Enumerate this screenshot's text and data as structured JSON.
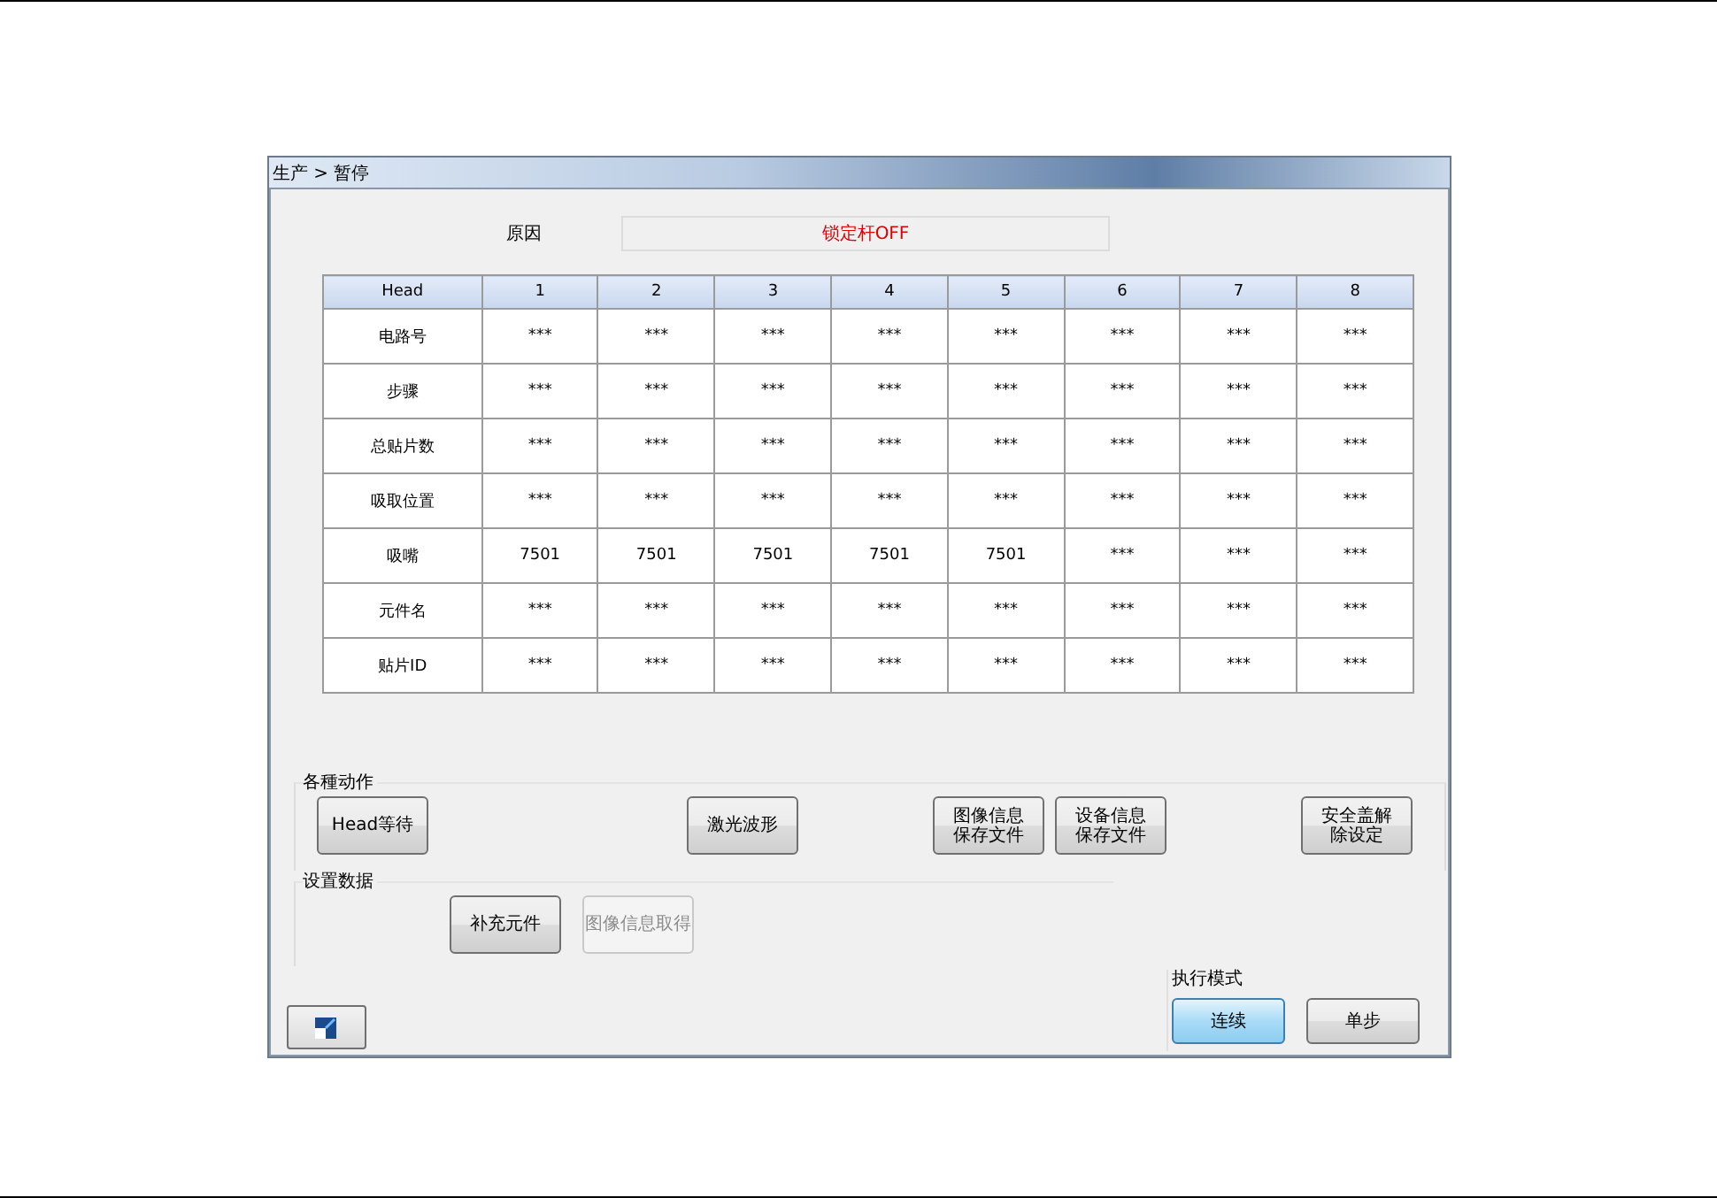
{
  "window": {
    "title": "生产 > 暂停"
  },
  "reason": {
    "label": "原因",
    "value": "锁定杆OFF"
  },
  "table": {
    "columns": [
      "Head",
      "1",
      "2",
      "3",
      "4",
      "5",
      "6",
      "7",
      "8"
    ],
    "rows": [
      {
        "cells": [
          "电路号",
          "***",
          "***",
          "***",
          "***",
          "***",
          "***",
          "***",
          "***"
        ]
      },
      {
        "cells": [
          "步骤",
          "***",
          "***",
          "***",
          "***",
          "***",
          "***",
          "***",
          "***"
        ]
      },
      {
        "cells": [
          "总贴片数",
          "***",
          "***",
          "***",
          "***",
          "***",
          "***",
          "***",
          "***"
        ]
      },
      {
        "cells": [
          "吸取位置",
          "***",
          "***",
          "***",
          "***",
          "***",
          "***",
          "***",
          "***"
        ]
      },
      {
        "cells": [
          "吸嘴",
          "7501",
          "7501",
          "7501",
          "7501",
          "7501",
          "***",
          "***",
          "***"
        ]
      },
      {
        "cells": [
          "元件名",
          "***",
          "***",
          "***",
          "***",
          "***",
          "***",
          "***",
          "***"
        ]
      },
      {
        "cells": [
          "贴片ID",
          "***",
          "***",
          "***",
          "***",
          "***",
          "***",
          "***",
          "***"
        ]
      }
    ]
  },
  "actions": {
    "title": "各種动作",
    "buttons": [
      {
        "label": "Head等待",
        "disabled": false
      },
      {
        "label": "激光波形",
        "disabled": false
      },
      {
        "label": "图像信息保存文件",
        "disabled": false
      },
      {
        "label": "设备信息保存文件",
        "disabled": false
      },
      {
        "label": "安全盖解除设定",
        "disabled": false
      }
    ]
  },
  "settings": {
    "title": "设置数据",
    "buttons": [
      {
        "label": "补充元件",
        "disabled": false
      },
      {
        "label": "图像信息取得",
        "disabled": true
      }
    ]
  },
  "mode": {
    "title": "执行模式",
    "buttons": [
      {
        "label": "连续",
        "selected": true
      },
      {
        "label": "单步",
        "selected": false
      }
    ]
  }
}
